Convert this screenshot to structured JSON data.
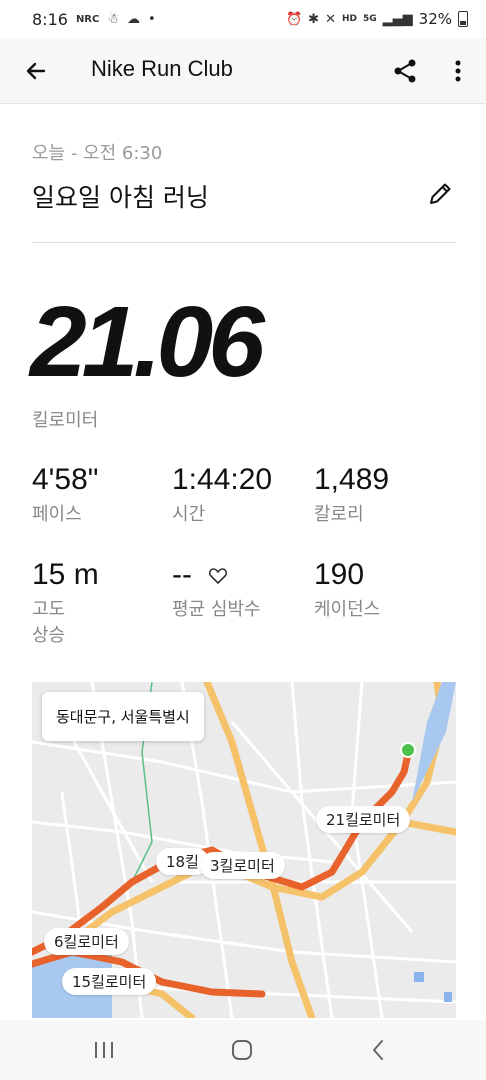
{
  "status_bar": {
    "time": "8:16",
    "app_icon_label": "NRC",
    "battery": "32%"
  },
  "app_bar": {
    "title": "Nike Run Club"
  },
  "activity": {
    "date": "오늘 - 오전 6:30",
    "name": "일요일 아침 러닝",
    "distance": "21.06",
    "distance_unit": "킬로미터"
  },
  "stats": [
    {
      "value": "4'58\"",
      "label": "페이스"
    },
    {
      "value": "1:44:20",
      "label": "시간"
    },
    {
      "value": "1,489",
      "label": "칼로리"
    },
    {
      "value": "15 m",
      "label": "고도\n상승"
    },
    {
      "value": "--",
      "label": "평균 심박수"
    },
    {
      "value": "190",
      "label": "케이던스"
    }
  ],
  "map": {
    "location": "동대문구, 서울특별시",
    "markers": [
      "21킬로미터",
      "18킬",
      "3킬로미터",
      "6킬로미터",
      "15킬로미터"
    ]
  }
}
